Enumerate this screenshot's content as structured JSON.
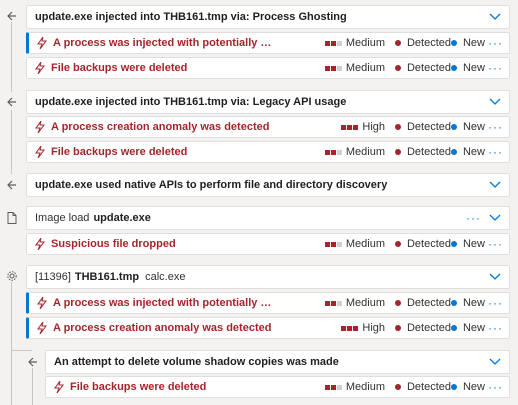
{
  "groups": [
    {
      "title": "update.exe injected into THB161.tmp via: Process Ghosting",
      "alerts": [
        {
          "title": "A process was injected with potentially malici...",
          "severity": "Medium",
          "status": "Detected",
          "state": "New"
        },
        {
          "title": "File backups were deleted",
          "severity": "Medium",
          "status": "Detected",
          "state": "New"
        }
      ]
    },
    {
      "title": "update.exe injected into THB161.tmp via: Legacy API usage",
      "alerts": [
        {
          "title": "A process creation anomaly was detected",
          "severity": "High",
          "status": "Detected",
          "state": "New"
        },
        {
          "title": "File backups were deleted",
          "severity": "Medium",
          "status": "Detected",
          "state": "New"
        }
      ]
    },
    {
      "title": "update.exe used native APIs to perform file and directory discovery",
      "alerts": []
    },
    {
      "prefix": "Image load",
      "title": "update.exe",
      "alerts": [
        {
          "title": "Suspicious file dropped",
          "severity": "Medium",
          "status": "Detected",
          "state": "New"
        }
      ]
    },
    {
      "prefix": "[11396]",
      "title": "THB161.tmp",
      "suffix": "calc.exe",
      "alerts": [
        {
          "title": "A process was injected with potentially malici...",
          "severity": "Medium",
          "status": "Detected",
          "state": "New"
        },
        {
          "title": "A process creation anomaly was detected",
          "severity": "High",
          "status": "Detected",
          "state": "New"
        }
      ]
    },
    {
      "title": "An attempt to delete volume shadow copies was made",
      "alerts": [
        {
          "title": "File backups were deleted",
          "severity": "Medium",
          "status": "Detected",
          "state": "New"
        }
      ]
    }
  ],
  "icons": {
    "alert": "lightning-icon",
    "event": "diamond-arrow-icon",
    "file": "file-icon",
    "process": "gear-icon",
    "expand": "chevron-down-icon",
    "more": "more-icon"
  },
  "colors": {
    "alert": "#a4262c",
    "accent": "#0078d4",
    "new": "#0078d4"
  }
}
